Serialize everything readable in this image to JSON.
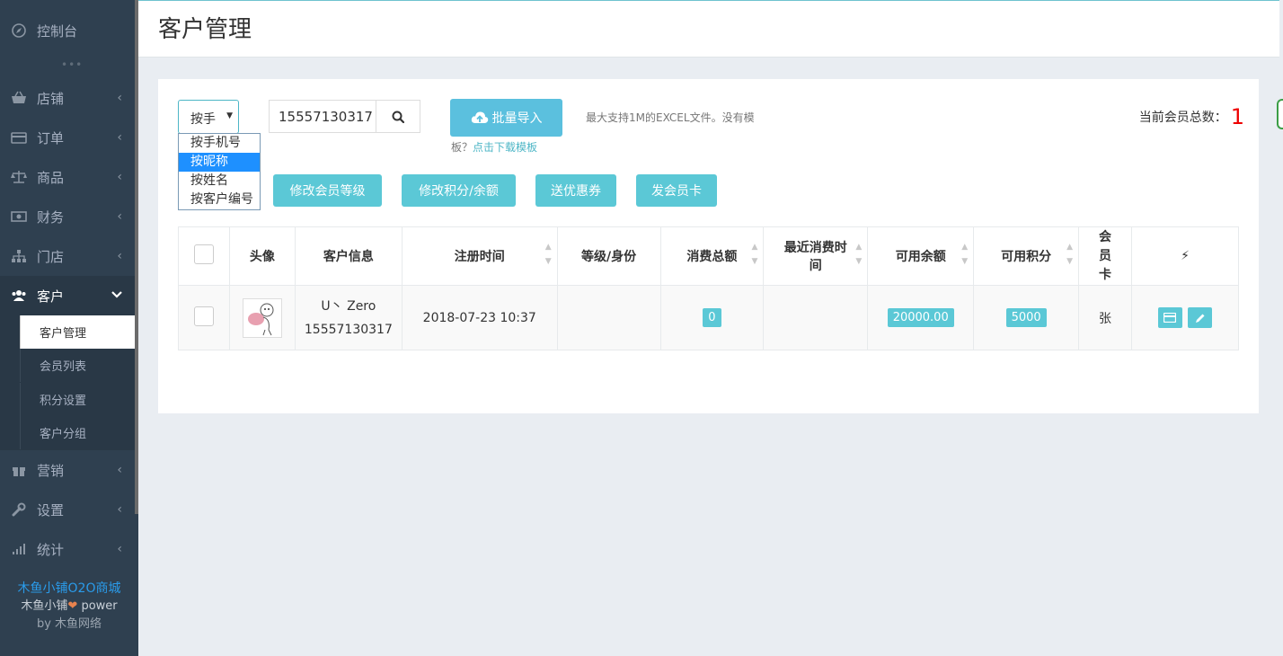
{
  "sidebar": {
    "items": [
      {
        "label": "控制台",
        "icon": "compass-icon",
        "chevron": false
      },
      {
        "label": "店铺",
        "icon": "basket-icon",
        "chevron": true
      },
      {
        "label": "订单",
        "icon": "credit-card-icon",
        "chevron": true
      },
      {
        "label": "商品",
        "icon": "balance-scale-icon",
        "chevron": true
      },
      {
        "label": "财务",
        "icon": "money-icon",
        "chevron": true
      },
      {
        "label": "门店",
        "icon": "sitemap-icon",
        "chevron": true
      },
      {
        "label": "客户",
        "icon": "users-icon",
        "chevron": true
      },
      {
        "label": "营销",
        "icon": "gift-icon",
        "chevron": true
      },
      {
        "label": "设置",
        "icon": "wrench-icon",
        "chevron": true
      },
      {
        "label": "统计",
        "icon": "signal-icon",
        "chevron": true
      }
    ],
    "dots": "•••",
    "submenu": [
      "客户管理",
      "会员列表",
      "积分设置",
      "客户分组"
    ],
    "footer": {
      "brand": "木鱼小铺O2O商城",
      "power": "木鱼小铺",
      "power_suffix": "power",
      "by": "by",
      "company": "木鱼网络"
    }
  },
  "header": {
    "title": "客户管理"
  },
  "filter": {
    "select_value": "按手",
    "options": [
      "按手机号",
      "按昵称",
      "按姓名",
      "按客户编号"
    ],
    "selected_index": 1,
    "search_value": "15557130317"
  },
  "import": {
    "label": "批量导入",
    "hint": "最大支持1M的EXCEL文件。没有模",
    "hint2_prefix": "板？",
    "hint2_link": "点击下载模板"
  },
  "member_count": {
    "label": "当前会员总数：",
    "value": "1"
  },
  "actions": [
    "修改会员等级",
    "修改积分/余额",
    "送优惠券",
    "发会员卡"
  ],
  "table": {
    "headers": [
      "",
      "头像",
      "客户信息",
      "注册时间",
      "等级/身份",
      "消费总额",
      "最近消费时间",
      "可用余额",
      "可用积分",
      "会员卡",
      "⚡"
    ],
    "rows": [
      {
        "nickname": "U丶 Zero",
        "phone": "15557130317",
        "reg_time": "2018-07-23 10:37",
        "level": "",
        "total_spent": "0",
        "last_spent": "",
        "balance": "20000.00",
        "points": "5000",
        "card": "张"
      }
    ]
  },
  "colors": {
    "sidebar_bg": "#2f4050",
    "accent": "#5bc8d6",
    "link": "#2a9bea",
    "count": "#ee0000"
  }
}
